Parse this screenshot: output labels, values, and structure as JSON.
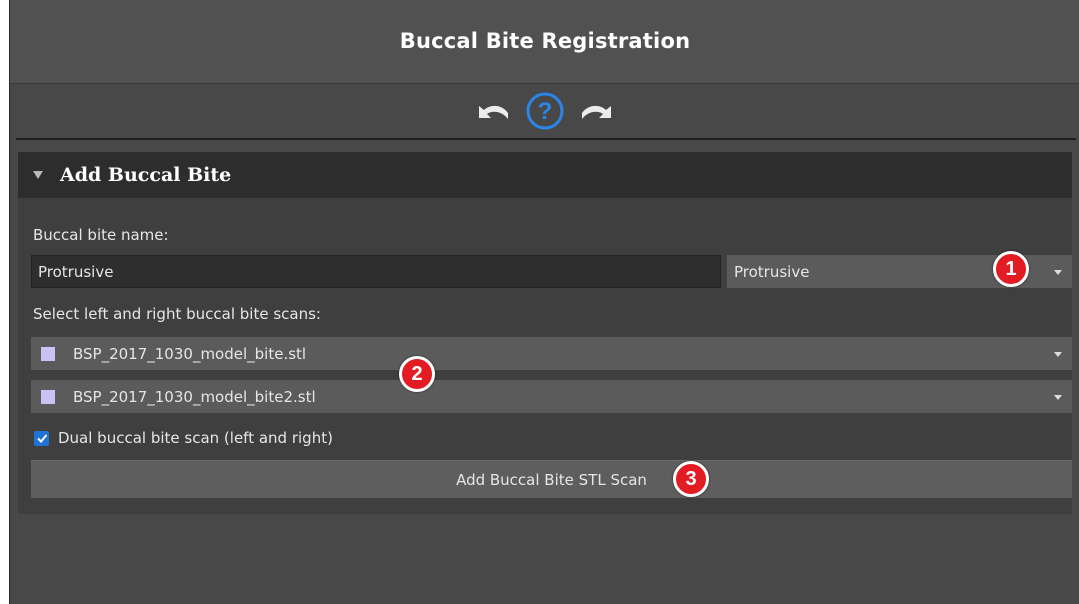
{
  "window": {
    "title": "Buccal Bite Registration"
  },
  "toolbar": {
    "undo_icon": "undo-icon",
    "help_icon": "help-icon",
    "redo_icon": "redo-icon",
    "help_glyph": "?"
  },
  "panel": {
    "header": "Add Buccal Bite",
    "name_label": "Buccal bite name:",
    "name_value": "Protrusive",
    "name_preset": "Protrusive",
    "scans_label": "Select left and right buccal bite scans:",
    "scans": [
      {
        "file": "BSP_2017_1030_model_bite.stl",
        "color": "#c9c3f4"
      },
      {
        "file": "BSP_2017_1030_model_bite2.stl",
        "color": "#c9c3f4"
      }
    ],
    "dual_label": "Dual buccal bite scan (left and right)",
    "dual_checked": true,
    "add_button": "Add Buccal Bite STL Scan"
  },
  "annotations": {
    "m1": "1",
    "m2": "2",
    "m3": "3"
  },
  "colors": {
    "accent": "#1e73d4",
    "marker": "#e31b23",
    "background": "#484848"
  }
}
